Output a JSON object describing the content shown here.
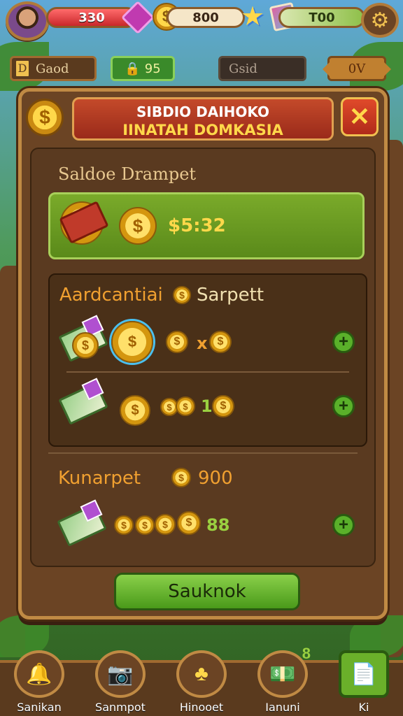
{
  "topbar": {
    "health_value": "330",
    "coins_value": "800",
    "gems_value": "T00"
  },
  "row2": {
    "left_label": "Gaod",
    "left_icon_text": "D",
    "mid_value": "95",
    "right_label": "Gsid",
    "far_label": "0V"
  },
  "panel": {
    "title_line1": "SIBDIO DAIHOKO",
    "title_line2": "IINATAH DOMKASIA",
    "balance_label": "Saldoe Drampet",
    "balance_value": "$5:32",
    "section1_title_left": "Aardcantiai",
    "section1_title_right": "Sarpett",
    "row1_qty": "x",
    "row2_qty": "1",
    "section2_title": "Kunarpet",
    "section2_value": "900",
    "row3_qty": "88",
    "confirm_label": "Sauknok"
  },
  "bottom_nav": [
    {
      "label": "Sanikan",
      "icon": "bell-icon"
    },
    {
      "label": "Sanmpot",
      "icon": "camera-icon"
    },
    {
      "label": "Hinooet",
      "icon": "clover-icon"
    },
    {
      "label": "Ianuni",
      "icon": "money-stack-icon",
      "badge": "8"
    },
    {
      "label": "Ki",
      "icon": "document-stack-icon"
    }
  ],
  "colors": {
    "accent_gold": "#ffd84a",
    "panel_brown": "#6b4424",
    "button_green": "#5ab02a",
    "header_red": "#c44a2a"
  }
}
